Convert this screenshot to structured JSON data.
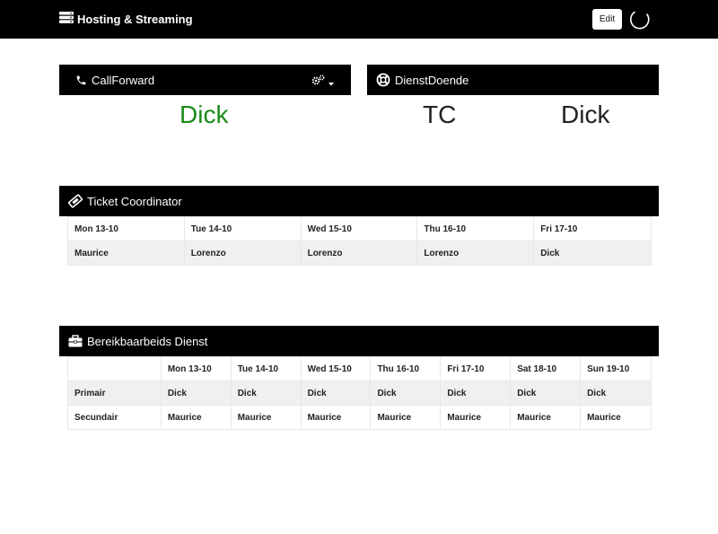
{
  "header": {
    "title": "Hosting & Streaming",
    "edit_label": "Edit"
  },
  "callforward": {
    "title": "CallForward",
    "value": "Dick",
    "value_color": "#1a8a1a"
  },
  "dienstdoende": {
    "title": "DienstDoende",
    "label": "TC",
    "value": "Dick"
  },
  "ticket": {
    "title": "Ticket Coordinator",
    "days": [
      "Mon 13-10",
      "Tue 14-10",
      "Wed 15-10",
      "Thu 16-10",
      "Fri 17-10"
    ],
    "names": [
      "Maurice",
      "Lorenzo",
      "Lorenzo",
      "Lorenzo",
      "Dick"
    ]
  },
  "bereik": {
    "title": "Bereikbaarbeids Dienst",
    "days": [
      "Mon 13-10",
      "Tue 14-10",
      "Wed 15-10",
      "Thu 16-10",
      "Fri 17-10",
      "Sat 18-10",
      "Sun 19-10"
    ],
    "rows": [
      {
        "label": "Primair",
        "names": [
          "Dick",
          "Dick",
          "Dick",
          "Dick",
          "Dick",
          "Dick",
          "Dick"
        ]
      },
      {
        "label": "Secundair",
        "names": [
          "Maurice",
          "Maurice",
          "Maurice",
          "Maurice",
          "Maurice",
          "Maurice",
          "Maurice"
        ]
      }
    ]
  },
  "icons": [
    "server-icon",
    "spinner-icon",
    "phone-icon",
    "gears-icon",
    "lifebuoy-icon",
    "ticket-icon",
    "briefcase-icon"
  ]
}
